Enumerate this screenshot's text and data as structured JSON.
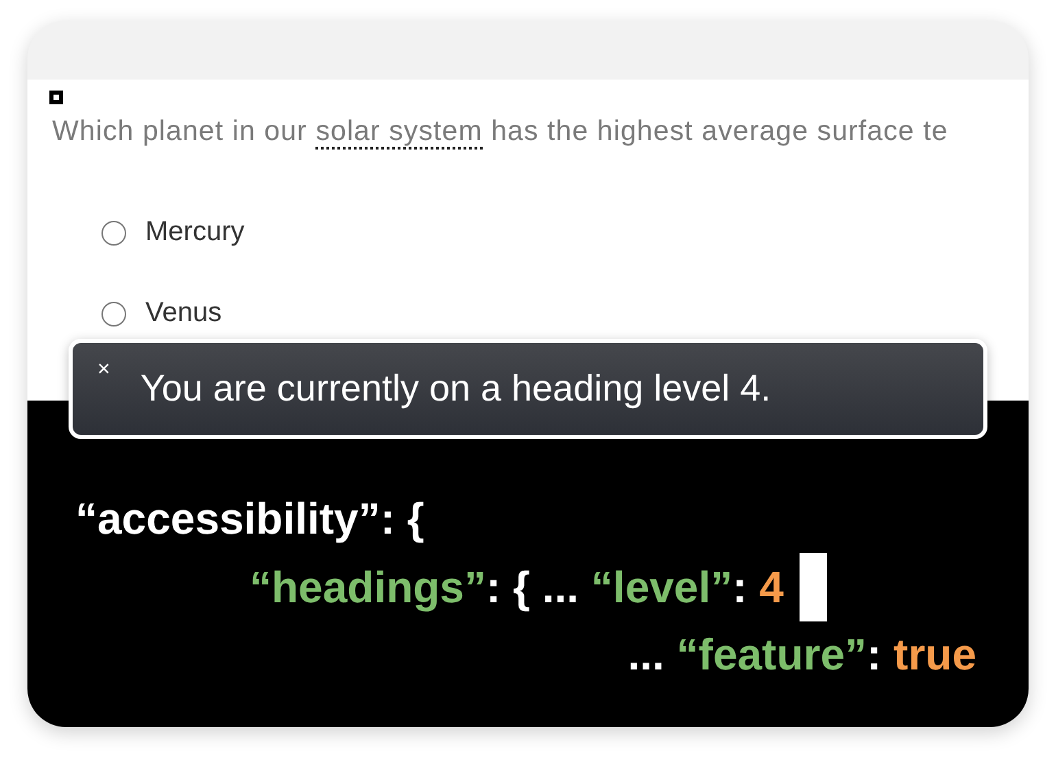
{
  "question": {
    "segments": [
      {
        "text": "Which planet in our ",
        "kind": "plain"
      },
      {
        "text": "solar system",
        "kind": "term"
      },
      {
        "text": " has the highest average surface te",
        "kind": "plain"
      }
    ]
  },
  "options": [
    {
      "label": "Mercury",
      "selected": false
    },
    {
      "label": "Venus",
      "selected": false
    }
  ],
  "tooltip": {
    "close": "×",
    "message": "You are currently on a heading level 4."
  },
  "code": [
    {
      "tokens": [
        {
          "text": "“accessibility”: {",
          "kind": "plain"
        }
      ]
    },
    {
      "tokens": [
        {
          "text": "“headings”",
          "kind": "key"
        },
        {
          "text": ": { ... ",
          "kind": "plain"
        },
        {
          "text": "“level”",
          "kind": "key"
        },
        {
          "text": ": ",
          "kind": "plain"
        },
        {
          "text": "4",
          "kind": "value"
        }
      ],
      "cursor": true
    },
    {
      "tokens": [
        {
          "text": "... ",
          "kind": "plain"
        },
        {
          "text": "“feature”",
          "kind": "key"
        },
        {
          "text": ": ",
          "kind": "plain"
        },
        {
          "text": "true",
          "kind": "value"
        }
      ]
    }
  ]
}
